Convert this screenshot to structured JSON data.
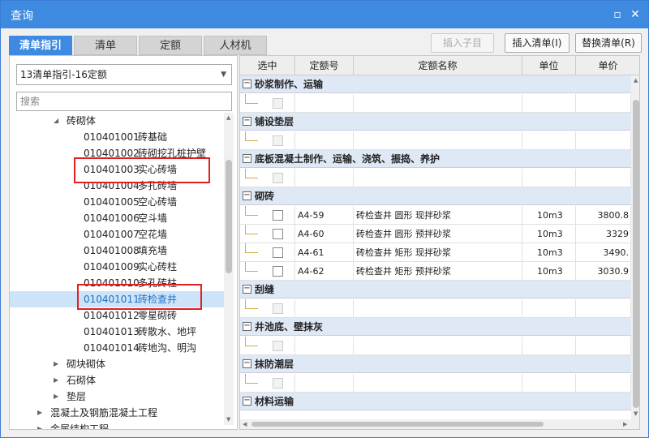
{
  "window": {
    "title": "查询"
  },
  "tabs": [
    "清单指引",
    "清单",
    "定额",
    "人材机"
  ],
  "toolbar": {
    "insert_child": "插入子目",
    "insert_list": "插入清单(I)",
    "replace_list": "替换清单(R)"
  },
  "left": {
    "select_value": "13清单指引-16定额",
    "search_placeholder": "搜索",
    "tree": [
      {
        "indent": 2,
        "expanded": true,
        "code": "",
        "name": "砖砌体"
      },
      {
        "indent": 3,
        "code": "010401001",
        "name": "砖基础"
      },
      {
        "indent": 3,
        "code": "010401002",
        "name": "砖砌挖孔桩护壁"
      },
      {
        "indent": 3,
        "code": "010401003",
        "name": "实心砖墙"
      },
      {
        "indent": 3,
        "code": "010401004",
        "name": "多孔砖墙"
      },
      {
        "indent": 3,
        "code": "010401005",
        "name": "空心砖墙"
      },
      {
        "indent": 3,
        "code": "010401006",
        "name": "空斗墙"
      },
      {
        "indent": 3,
        "code": "010401007",
        "name": "空花墙"
      },
      {
        "indent": 3,
        "code": "010401008",
        "name": "填充墙"
      },
      {
        "indent": 3,
        "code": "010401009",
        "name": "实心砖柱"
      },
      {
        "indent": 3,
        "code": "010401010",
        "name": "多孔砖柱"
      },
      {
        "indent": 3,
        "code": "010401011",
        "name": "砖检查井",
        "selected": true
      },
      {
        "indent": 3,
        "code": "010401012",
        "name": "零星砌砖"
      },
      {
        "indent": 3,
        "code": "010401013",
        "name": "砖散水、地坪"
      },
      {
        "indent": 3,
        "code": "010401014",
        "name": "砖地沟、明沟"
      },
      {
        "indent": 2,
        "expanded": false,
        "code": "",
        "name": "砌块砌体"
      },
      {
        "indent": 2,
        "expanded": false,
        "code": "",
        "name": "石砌体"
      },
      {
        "indent": 2,
        "expanded": false,
        "code": "",
        "name": "垫层"
      },
      {
        "indent": 1,
        "expanded": false,
        "code": "",
        "name": "混凝土及钢筋混凝土工程"
      },
      {
        "indent": 1,
        "expanded": false,
        "code": "",
        "name": "金属结构工程"
      }
    ]
  },
  "grid": {
    "headers": [
      "选中",
      "定额号",
      "定额名称",
      "单位",
      "单价"
    ],
    "groups": [
      {
        "title": "砂浆制作、运输",
        "rows": [
          {
            "empty": true
          }
        ]
      },
      {
        "title": "铺设垫层",
        "rows": [
          {
            "empty": true
          }
        ]
      },
      {
        "title": "底板混凝土制作、运输、浇筑、振捣、养护",
        "rows": [
          {
            "empty": true
          }
        ]
      },
      {
        "title": "砌砖",
        "rows": [
          {
            "code": "A4-59",
            "name": "砖检查井 圆形 现拌砂浆",
            "unit": "10m3",
            "price": "3800.8"
          },
          {
            "code": "A4-60",
            "name": "砖检查井 圆形 预拌砂浆",
            "unit": "10m3",
            "price": "3329"
          },
          {
            "code": "A4-61",
            "name": "砖检查井 矩形 现拌砂浆",
            "unit": "10m3",
            "price": "3490."
          },
          {
            "code": "A4-62",
            "name": "砖检查井 矩形 预拌砂浆",
            "unit": "10m3",
            "price": "3030.9"
          }
        ]
      },
      {
        "title": "刮缝",
        "rows": [
          {
            "empty": true
          }
        ]
      },
      {
        "title": "井池底、壁抹灰",
        "rows": [
          {
            "empty": true
          }
        ]
      },
      {
        "title": "抹防潮层",
        "rows": [
          {
            "empty": true
          }
        ]
      },
      {
        "title": "材料运输",
        "rows": []
      }
    ]
  },
  "colors": {
    "accent": "#3d8ae0",
    "highlight": "#e02020",
    "selected_row": "#cde3f7"
  }
}
